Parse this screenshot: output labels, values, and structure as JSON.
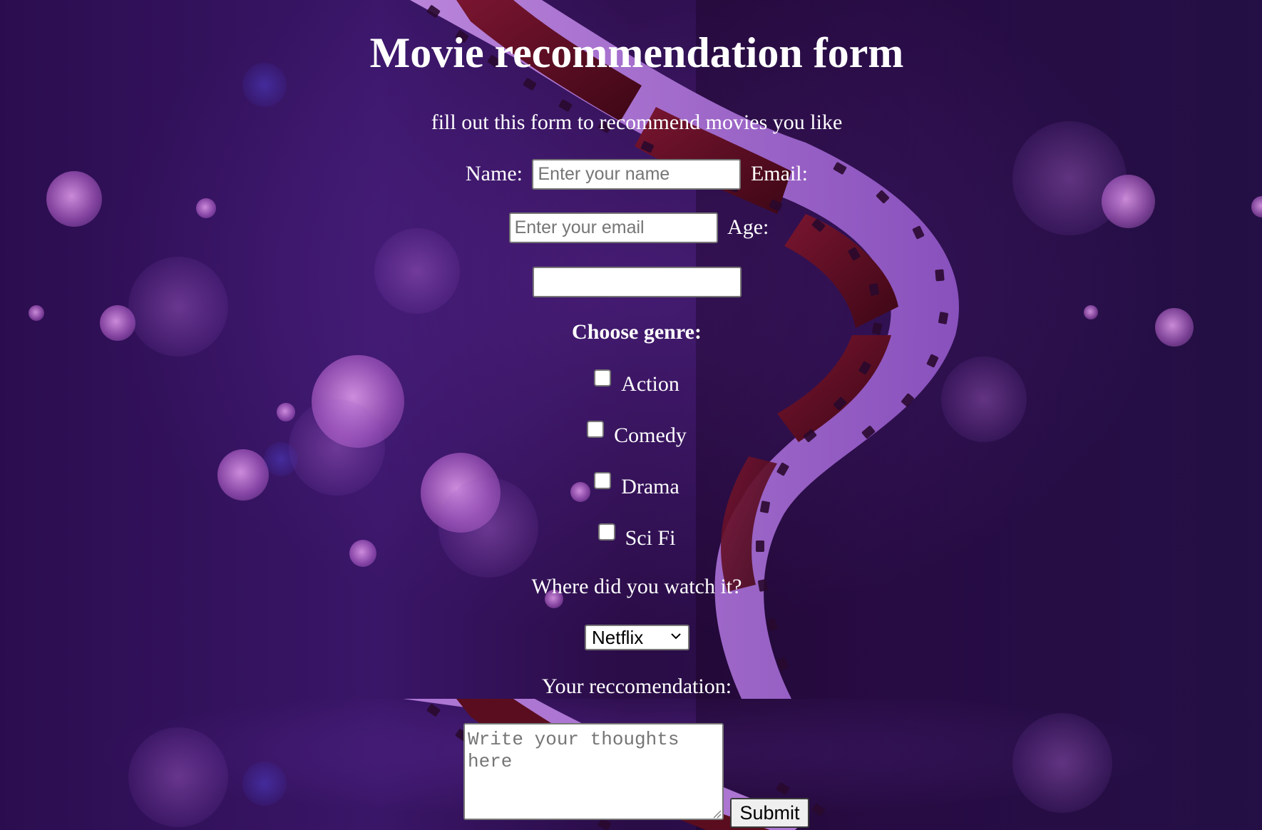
{
  "header": {
    "title": "Movie recommendation form",
    "subtitle": "fill out this form to recommend movies you like"
  },
  "form": {
    "name_label": "Name:",
    "name_placeholder": "Enter your name",
    "email_label": "Email:",
    "email_placeholder": "Enter your email",
    "age_label": "Age:",
    "age_value": "",
    "genre_heading": "Choose genre:",
    "genres": [
      {
        "label": "Action",
        "checked": false
      },
      {
        "label": "Comedy",
        "checked": false
      },
      {
        "label": "Drama",
        "checked": false
      },
      {
        "label": "Sci Fi",
        "checked": false
      }
    ],
    "platform_question": "Where did you watch it?",
    "platform_selected": "Netflix",
    "recommendation_label": "Your reccomendation:",
    "recommendation_placeholder": "Write your thoughts here",
    "submit_label": "Submit"
  },
  "icons": {
    "select_chevron": "chevron-down-icon",
    "textarea_resize": "resize-grip-icon"
  },
  "colors": {
    "background_primary": "#2a0f4a",
    "text": "#ffffff",
    "bokeh_pink": "#d58ee8",
    "film_frame": "#b57ad9",
    "film_cell": "#5a0d1e"
  }
}
